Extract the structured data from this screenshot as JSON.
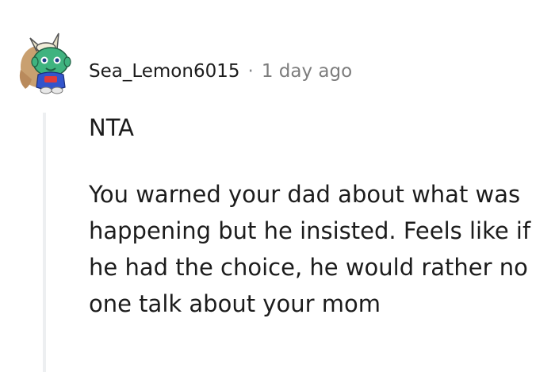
{
  "comment": {
    "author": "Sea_Lemon6015",
    "separator": "·",
    "timestamp": "1 day ago",
    "paragraphs": [
      "NTA",
      "You warned your dad about what was happening but he insisted. Feels like if he had the choice, he would rather no one talk about your mom"
    ]
  },
  "avatar": {
    "icon": "snoo-avatar-icon",
    "colors": {
      "body": "#3fb37f",
      "hair": "#c9a070",
      "shirt": "#3355cc",
      "accent": "#e23b3b"
    }
  },
  "colors": {
    "author": "#1c1c1c",
    "timestamp": "#7c7c7c",
    "body_text": "#1c1c1c",
    "thread_line": "#edeff1"
  }
}
